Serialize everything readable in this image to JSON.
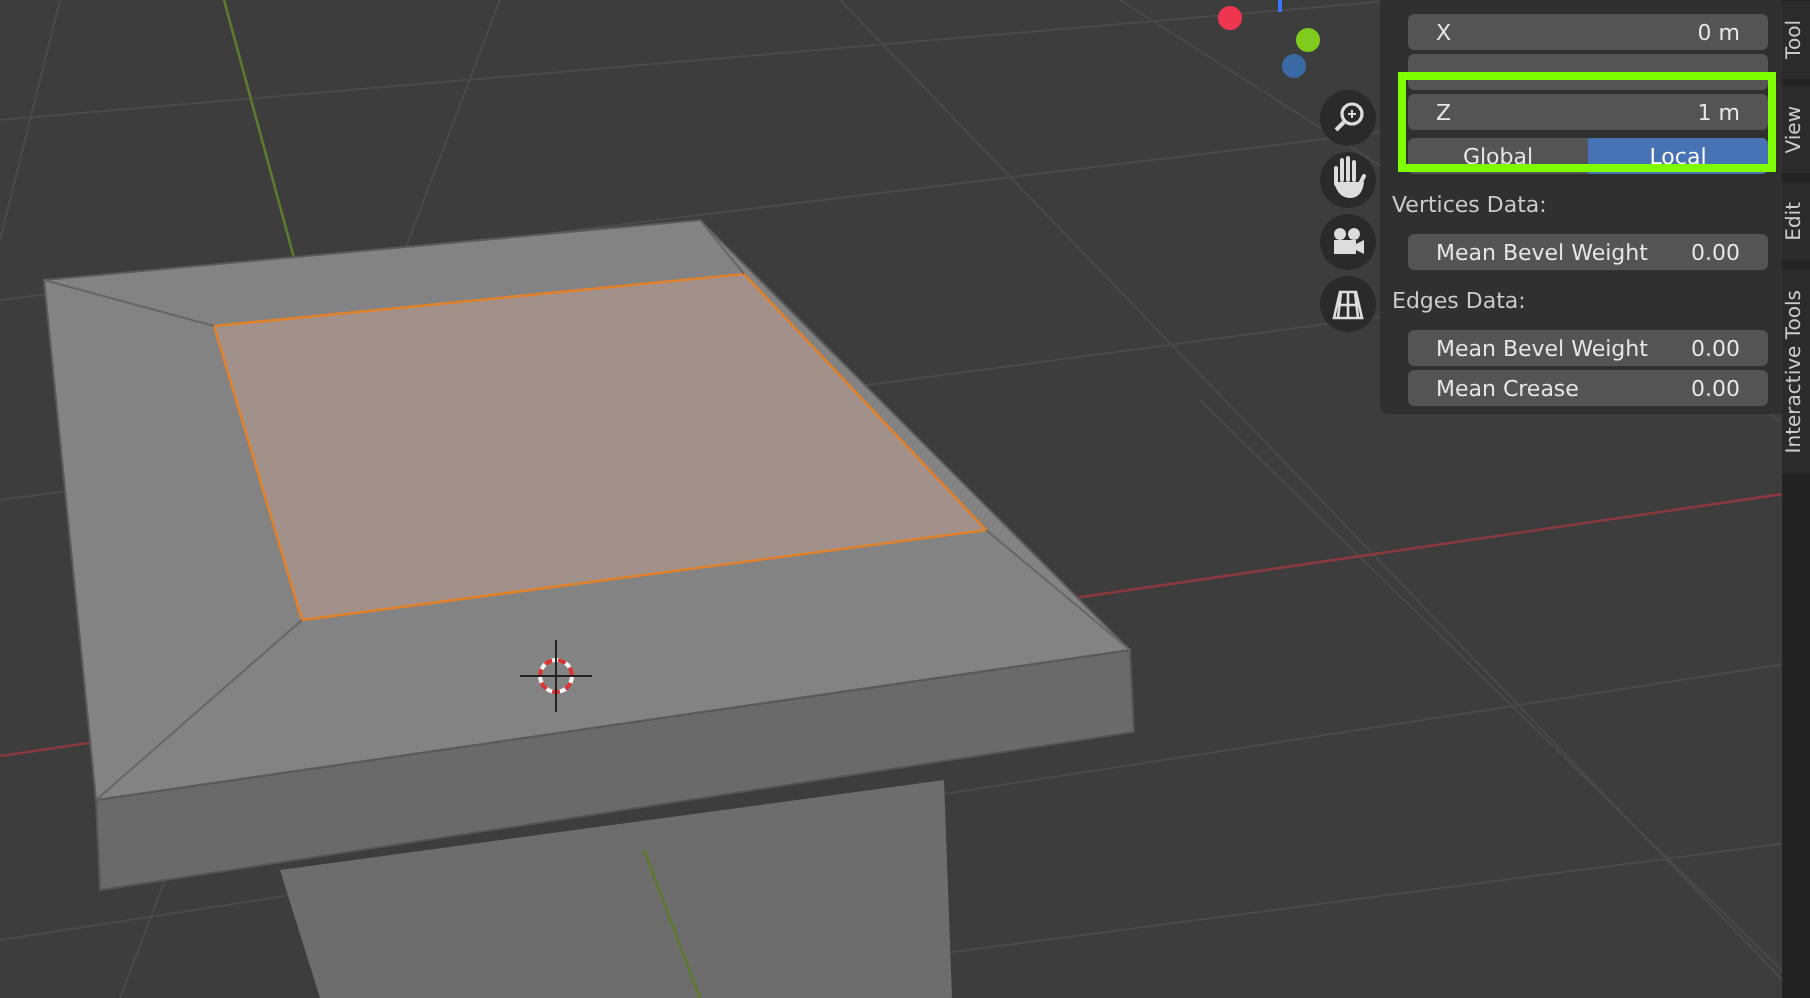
{
  "panel": {
    "items": [
      {
        "kind": "field",
        "label": "X",
        "value": "0 m"
      },
      {
        "kind": "hidden"
      },
      {
        "kind": "field",
        "label": "Z",
        "value": "1 m"
      },
      {
        "kind": "toggle",
        "options": [
          {
            "label": "Global",
            "selected": false
          },
          {
            "label": "Local",
            "selected": true
          }
        ]
      },
      {
        "kind": "heading",
        "label": "Vertices Data:"
      },
      {
        "kind": "field",
        "label": "Mean Bevel Weight",
        "value": "0.00"
      },
      {
        "kind": "heading",
        "label": "Edges Data:"
      },
      {
        "kind": "field",
        "label": "Mean Bevel Weight",
        "value": "0.00"
      },
      {
        "kind": "field",
        "label": "Mean Crease",
        "value": "0.00"
      }
    ]
  },
  "side_tabs": [
    "Tool",
    "View",
    "Edit",
    "Interactive Tools"
  ]
}
